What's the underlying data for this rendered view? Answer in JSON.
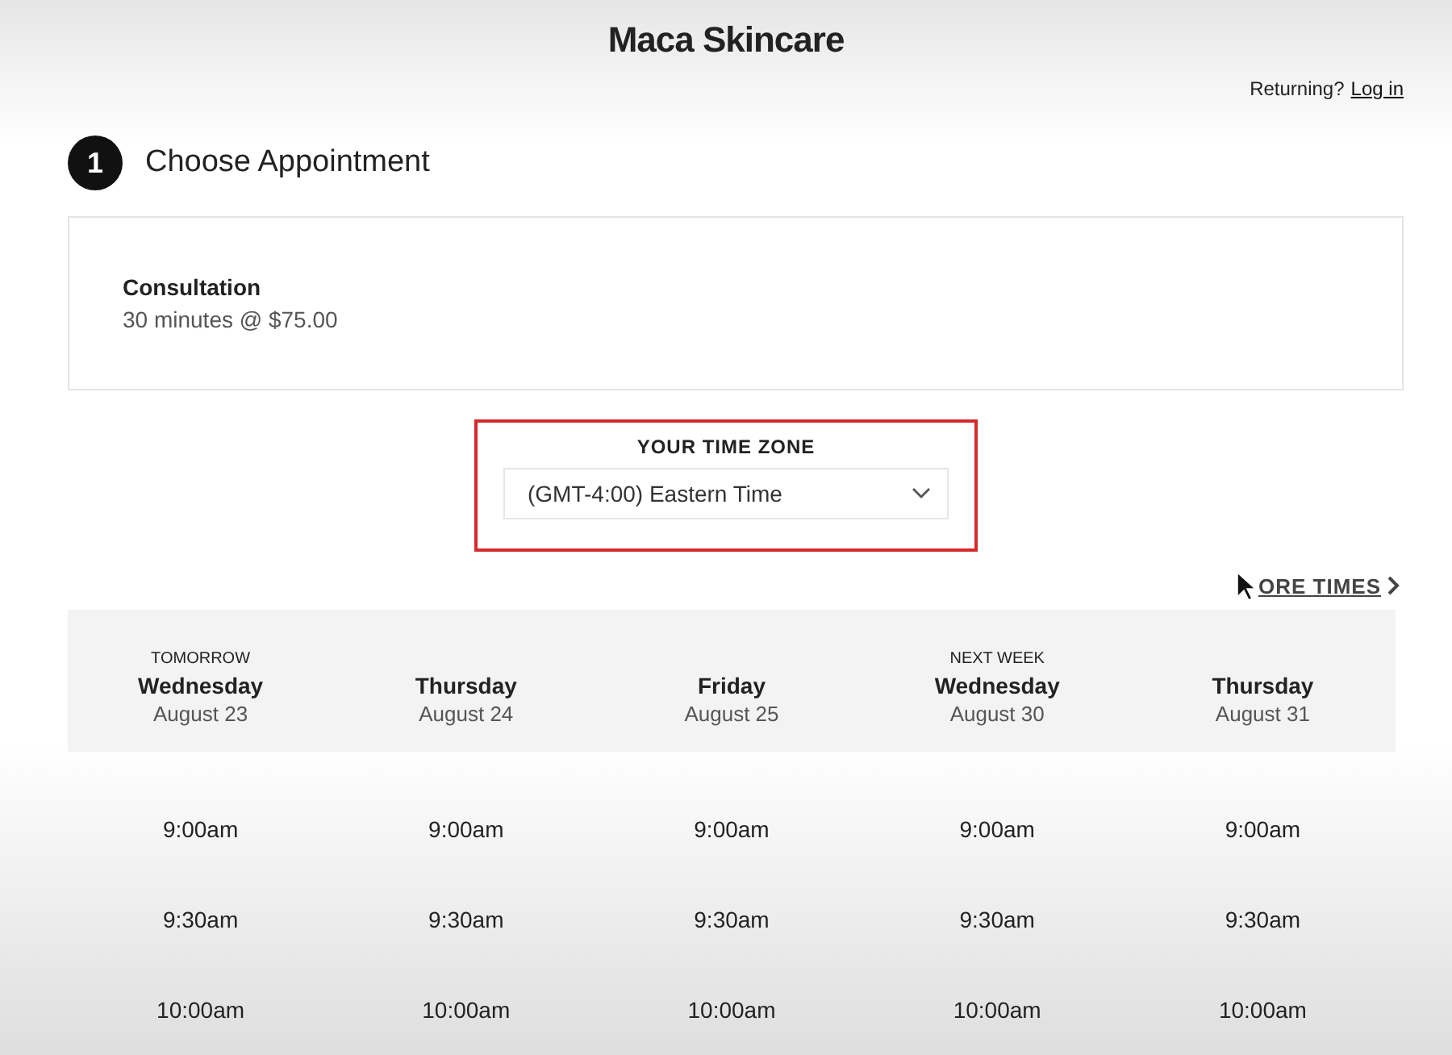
{
  "header": {
    "title": "Maca Skincare",
    "returning": "Returning?",
    "login": "Log in"
  },
  "step": {
    "number": "1",
    "title": "Choose Appointment"
  },
  "appointment": {
    "name": "Consultation",
    "details": "30 minutes @ $75.00"
  },
  "timezone": {
    "label": "YOUR TIME ZONE",
    "value": "(GMT-4:00) Eastern Time"
  },
  "more_times": "ORE TIMES",
  "days": [
    {
      "note": "TOMORROW",
      "weekday": "Wednesday",
      "date": "August 23",
      "times": [
        "9:00am",
        "9:30am",
        "10:00am"
      ]
    },
    {
      "weekday": "Thursday",
      "date": "August 24",
      "times": [
        "9:00am",
        "9:30am",
        "10:00am"
      ]
    },
    {
      "weekday": "Friday",
      "date": "August 25",
      "times": [
        "9:00am",
        "9:30am",
        "10:00am"
      ]
    },
    {
      "note": "NEXT WEEK",
      "weekday": "Wednesday",
      "date": "August 30",
      "times": [
        "9:00am",
        "9:30am",
        "10:00am"
      ]
    },
    {
      "weekday": "Thursday",
      "date": "August 31",
      "times": [
        "9:00am",
        "9:30am",
        "10:00am"
      ]
    }
  ]
}
